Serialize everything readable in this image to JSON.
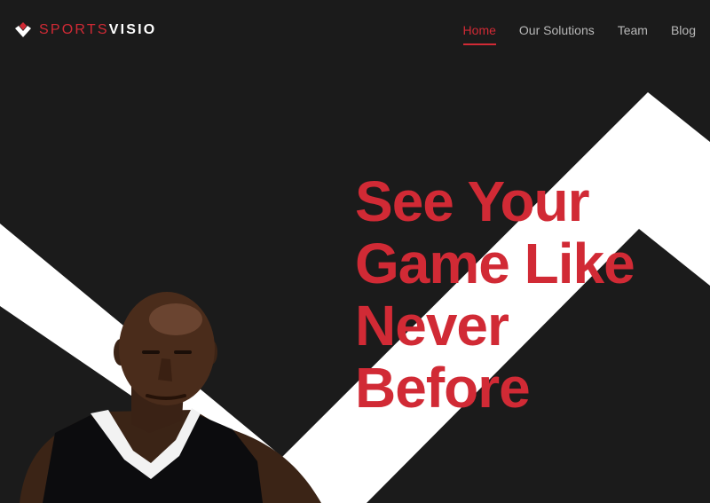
{
  "header": {
    "logo": {
      "icon": "sportsvisio-logo-icon",
      "text_part1": "SPORTS",
      "text_part2": "VISIO"
    },
    "nav": [
      {
        "label": "Home",
        "active": true
      },
      {
        "label": "Our Solutions",
        "active": false
      },
      {
        "label": "Team",
        "active": false
      },
      {
        "label": "Blog",
        "active": false
      }
    ]
  },
  "hero": {
    "headline_lines": [
      "See Your",
      "Game Like",
      "Never",
      "Before"
    ],
    "image": "basketball-player-photo"
  },
  "colors": {
    "background": "#1b1b1b",
    "accent": "#d12a35",
    "chevron": "#ffffff",
    "nav_text": "#b8b8b8"
  }
}
